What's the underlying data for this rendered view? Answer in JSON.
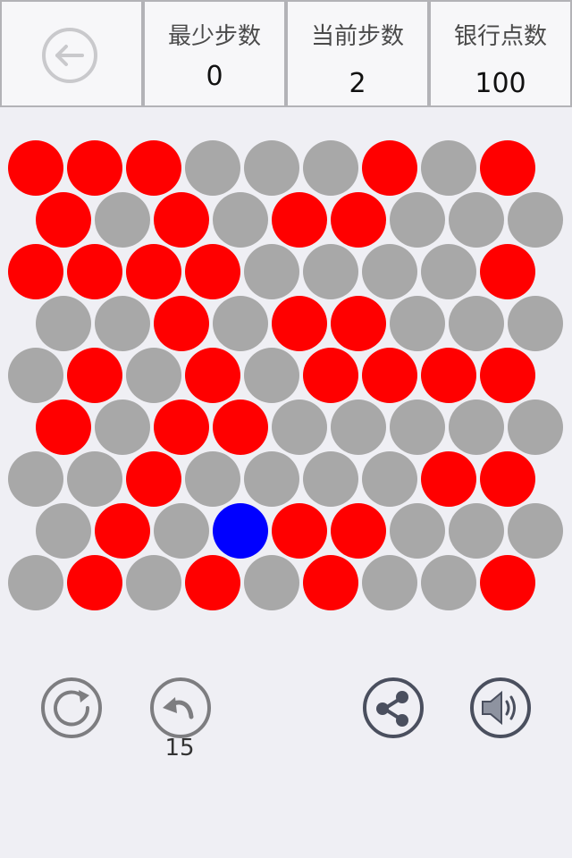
{
  "header": {
    "back_icon": "arrow-left-circle-icon",
    "stats": [
      {
        "label": "最少步数",
        "value": "0"
      },
      {
        "label": "当前步数",
        "value": "2"
      },
      {
        "label": "银行点数",
        "value": "100"
      }
    ]
  },
  "board": {
    "rows": 9,
    "cols": 9,
    "colors": {
      "red": "#ff0000",
      "gray": "#a8a8a8",
      "blue": "#0000ff"
    },
    "cells": [
      [
        "red",
        "red",
        "red",
        "gray",
        "gray",
        "gray",
        "red",
        "gray",
        "red"
      ],
      [
        "red",
        "gray",
        "red",
        "gray",
        "red",
        "red",
        "gray",
        "gray",
        "gray"
      ],
      [
        "red",
        "red",
        "red",
        "red",
        "gray",
        "gray",
        "gray",
        "gray",
        "red"
      ],
      [
        "gray",
        "gray",
        "red",
        "gray",
        "red",
        "red",
        "gray",
        "gray",
        "gray"
      ],
      [
        "gray",
        "red",
        "gray",
        "red",
        "gray",
        "red",
        "red",
        "red",
        "red"
      ],
      [
        "red",
        "gray",
        "red",
        "red",
        "gray",
        "gray",
        "gray",
        "gray",
        "gray"
      ],
      [
        "gray",
        "gray",
        "red",
        "gray",
        "gray",
        "gray",
        "gray",
        "red",
        "red"
      ],
      [
        "gray",
        "red",
        "gray",
        "blue",
        "red",
        "red",
        "gray",
        "gray",
        "gray"
      ],
      [
        "gray",
        "red",
        "gray",
        "red",
        "gray",
        "red",
        "gray",
        "gray",
        "red"
      ]
    ]
  },
  "toolbar": {
    "restart_icon": "restart-icon",
    "undo_icon": "undo-icon",
    "undo_count": "15",
    "share_icon": "share-icon",
    "sound_icon": "speaker-icon"
  }
}
